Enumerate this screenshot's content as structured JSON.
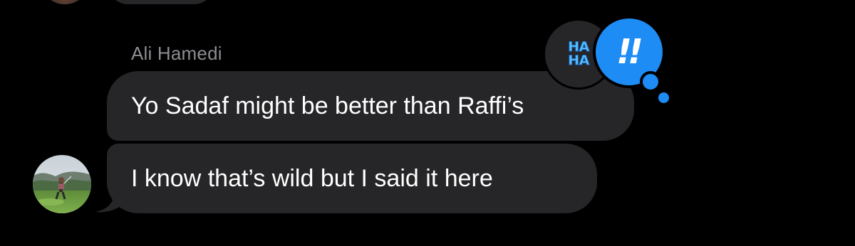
{
  "conversation": {
    "sender_name": "Ali Hamedi",
    "messages": [
      {
        "text": "Yo Sadaf might be better than Raffi’s"
      },
      {
        "text": "I know that’s wild but I said it here"
      }
    ],
    "reactions": {
      "haha": {
        "label": "HA HA",
        "line1": "HA",
        "line2": "HA"
      },
      "emphasize": {
        "label": "!!"
      }
    }
  },
  "colors": {
    "background": "#000000",
    "bubble_incoming": "#262628",
    "sender_name": "#8d8d93",
    "reaction_blue": "#1e8cf5"
  },
  "icons": {
    "haha_reaction": "haha-tapback-icon",
    "emphasize_reaction": "double-exclamation-icon",
    "avatar": "contact-avatar-photo"
  }
}
